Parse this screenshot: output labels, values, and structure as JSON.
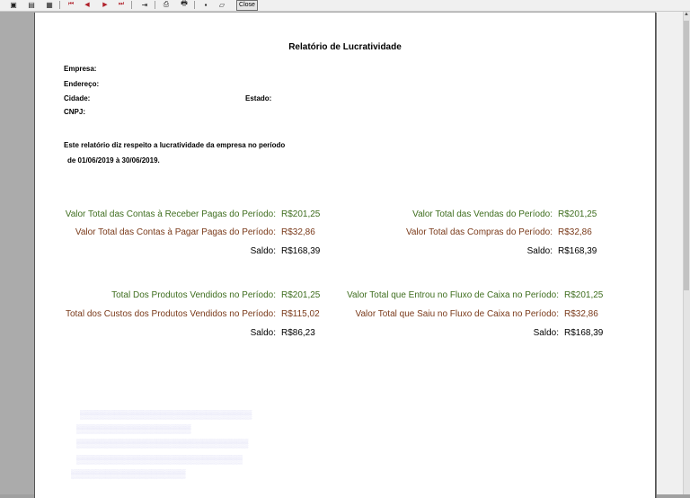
{
  "toolbar": {
    "close_label": "Close"
  },
  "report": {
    "title": "Relatório de Lucratividade",
    "empresa_label": "Empresa:",
    "endereco_label": "Endereço:",
    "cidade_label": "Cidade:",
    "estado_label": "Estado:",
    "cnpj_label": "CNPJ:",
    "description_line1": "Este relatório diz respeito a lucratividade da empresa  no período",
    "description_line2": "de 01/06/2019 à 30/06/2019."
  },
  "block1": {
    "label1": "Valor Total das Contas à Receber Pagas do Período:",
    "value1": "R$201,25",
    "label2": "Valor Total das Contas à Pagar Pagas do Período:",
    "value2": "R$32,86",
    "saldo_label": "Saldo:",
    "saldo_value": "R$168,39"
  },
  "block2": {
    "label1": "Valor Total das Vendas do Período:",
    "value1": "R$201,25",
    "label2": "Valor Total das Compras do Período:",
    "value2": "R$32,86",
    "saldo_label": "Saldo:",
    "saldo_value": "R$168,39"
  },
  "block3": {
    "label1": "Total Dos Produtos Vendidos no Período:",
    "value1": "R$201,25",
    "label2": "Total dos Custos dos Produtos Vendidos no Período:",
    "value2": "R$115,02",
    "saldo_label": "Saldo:",
    "saldo_value": "R$86,23"
  },
  "block4": {
    "label1": "Valor Total que Entrou no Fluxo de Caixa no Período:",
    "value1": "R$201,25",
    "label2": "Valor Total que Saiu no Fluxo de Caixa no Período:",
    "value2": "R$32,86",
    "saldo_label": "Saldo:",
    "saldo_value": "R$168,39"
  }
}
